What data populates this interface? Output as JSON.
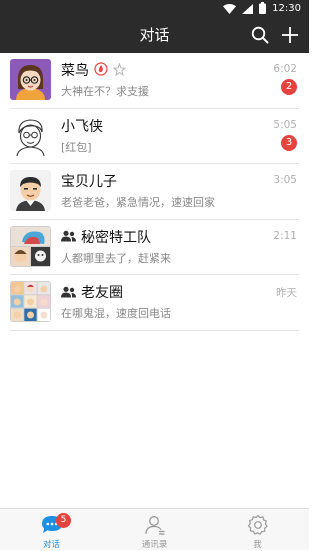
{
  "status_bar": {
    "time": "12:30"
  },
  "header": {
    "title": "对话",
    "icons": [
      "search-icon",
      "plus-icon"
    ]
  },
  "conversations": [
    {
      "name": "菜鸟",
      "preview": "大神在不？求支援",
      "time": "6:02",
      "unread": "2",
      "tags": [
        "fire-badge",
        "star-badge"
      ],
      "avatar": "cartoon-girl"
    },
    {
      "name": "小飞侠",
      "preview": "[红包]",
      "time": "5:05",
      "unread": "3",
      "avatar": "sketch-man"
    },
    {
      "name": "宝贝儿子",
      "preview": "老爸老爸，紧急情况，速速回家",
      "time": "3:05",
      "avatar": "cartoon-boy"
    },
    {
      "name": "秘密特工队",
      "preview": "人都哪里去了，赶紧来",
      "time": "2:11",
      "is_group": true,
      "avatar": "group-mosaic"
    },
    {
      "name": "老友圈",
      "preview": "在哪鬼混，速度回电话",
      "time": "昨天",
      "is_group": true,
      "avatar": "group-mosaic"
    }
  ],
  "bottom_nav": [
    {
      "label": "对话",
      "icon": "chat-icon",
      "active": true,
      "badge": "5"
    },
    {
      "label": "通讯录",
      "icon": "contacts-icon",
      "active": false
    },
    {
      "label": "我",
      "icon": "gear-icon",
      "active": false
    }
  ],
  "colors": {
    "header_bg": "#2b2b2b",
    "accent": "#1e8fe1",
    "badge": "#e5433e"
  }
}
